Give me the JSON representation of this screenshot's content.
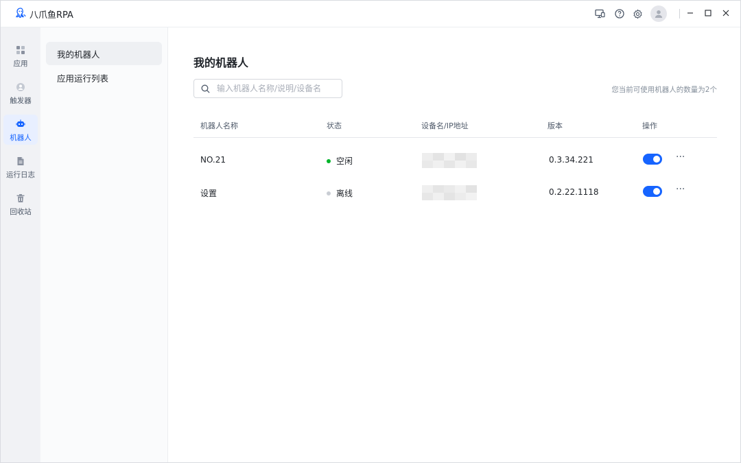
{
  "app": {
    "title": "八爪鱼RPA"
  },
  "titlebar": {
    "icons": [
      "monitor-icon",
      "help-icon",
      "settings-icon",
      "avatar-icon"
    ],
    "window_controls": [
      "minimize-icon",
      "maximize-icon",
      "close-icon"
    ]
  },
  "rail": {
    "items": [
      {
        "label": "应用",
        "icon": "apps-icon",
        "active": false
      },
      {
        "label": "触发器",
        "icon": "trigger-icon",
        "active": false
      },
      {
        "label": "机器人",
        "icon": "robot-icon",
        "active": true
      },
      {
        "label": "运行日志",
        "icon": "log-icon",
        "active": false
      },
      {
        "label": "回收站",
        "icon": "trash-icon",
        "active": false
      }
    ]
  },
  "subnav": {
    "items": [
      {
        "label": "我的机器人",
        "active": true
      },
      {
        "label": "应用运行列表",
        "active": false
      }
    ]
  },
  "main": {
    "title": "我的机器人",
    "search": {
      "placeholder": "输入机器人名称/说明/设备名",
      "value": ""
    },
    "quota_text": "您当前可使用机器人的数量为2个",
    "table": {
      "headers": [
        "机器人名称",
        "状态",
        "设备名/IP地址",
        "版本",
        "操作"
      ],
      "rows": [
        {
          "name": "NO.21",
          "status": "空闲",
          "status_color": "#00b42a",
          "device": "",
          "version": "0.3.34.221",
          "enabled": true
        },
        {
          "name": "设置",
          "status": "离线",
          "status_color": "#c9cdd4",
          "device": "",
          "version": "0.2.22.1118",
          "enabled": true
        }
      ],
      "more_label": "···"
    }
  },
  "colors": {
    "accent": "#1664ff",
    "rail_bg": "#f1f2f5",
    "online": "#00b42a",
    "offline": "#c9cdd4"
  }
}
